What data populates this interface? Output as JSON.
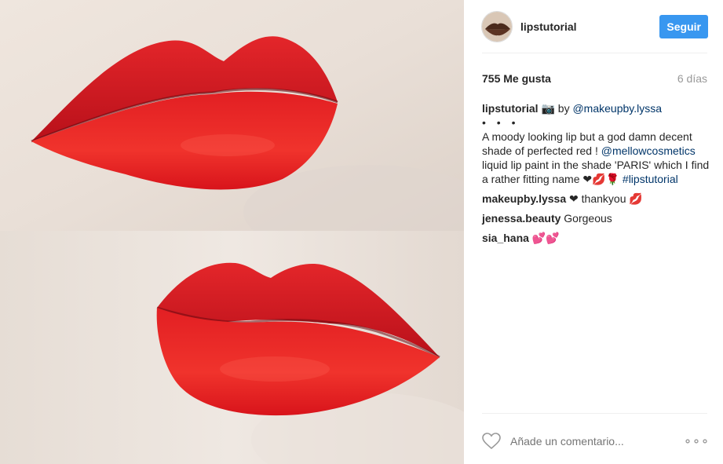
{
  "post": {
    "username": "lipstutorial",
    "follow_label": "Seguir",
    "likes": "755 Me gusta",
    "age": "6 días"
  },
  "caption": {
    "author": "lipstutorial",
    "camera": "📷",
    "by": " by ",
    "credit": "@makeupby.lyssa",
    "dots": "• • •",
    "text1": "A moody looking lip but a god damn decent shade of perfected red ! ",
    "mention": "@mellowcosmetics",
    "text2": " liquid lip paint in the shade 'PARIS' which I find a rather fitting name ",
    "heart": "❤",
    "lips": "💋",
    "rose": "🌹",
    "hashtag": "#lipstutorial"
  },
  "comments": [
    {
      "user": "makeupby.lyssa",
      "heart": " ❤ ",
      "text": "thankyou ",
      "emoji": "💋"
    },
    {
      "user": "jenessa.beauty",
      "text": " Gorgeous"
    },
    {
      "user": "sia_hana",
      "emoji": " 💕💕"
    }
  ],
  "footer": {
    "placeholder": "Añade un comentario...",
    "more": "∘∘∘"
  },
  "colors": {
    "follow_bg": "#3897f0",
    "link": "#003569",
    "muted": "#999999",
    "lip_red": "#e11f1f"
  }
}
